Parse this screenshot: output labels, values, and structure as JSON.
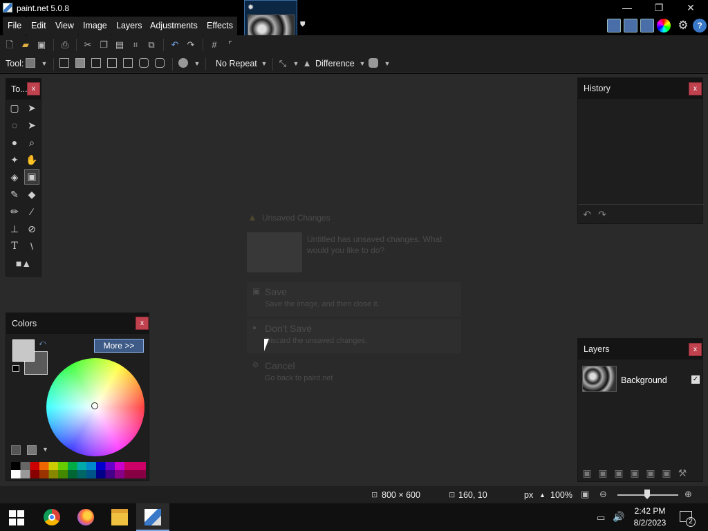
{
  "window": {
    "title": "paint.net 5.0.8",
    "minimize": "—",
    "restore": "❐",
    "close": "✕"
  },
  "menu": [
    "File",
    "Edit",
    "View",
    "Image",
    "Layers",
    "Adjustments",
    "Effects"
  ],
  "toolbar": {
    "tool_label": "Tool:",
    "repeat_mode": "No Repeat",
    "blend_mode": "Difference"
  },
  "tools_panel": {
    "title": "To...",
    "close": "x"
  },
  "history_panel": {
    "title": "History",
    "close": "x"
  },
  "colors_panel": {
    "title": "Colors",
    "close": "x",
    "more_button": "More >>"
  },
  "layers_panel": {
    "title": "Layers",
    "close": "x",
    "layers": [
      {
        "name": "Background",
        "visible": true
      }
    ]
  },
  "dialog": {
    "title": "Unsaved Changes",
    "message": "Untitled has unsaved changes. What would you like to do?",
    "options": [
      {
        "title": "Save",
        "desc": "Save the image, and then close it."
      },
      {
        "title": "Don't Save",
        "desc": "Discard the unsaved changes."
      },
      {
        "title": "Cancel",
        "desc": "Go back to paint.net"
      }
    ]
  },
  "status": {
    "image_size": "800 × 600",
    "cursor_pos": "160, 10",
    "units": "px",
    "zoom": "100%"
  },
  "taskbar": {
    "time": "2:42 PM",
    "date": "8/2/2023",
    "notifications": "2"
  },
  "colors": {
    "primary": "#c8c8c8",
    "secondary": "#5a5a5a",
    "accent": "#3c6ea5",
    "close_red": "#c0424f"
  }
}
